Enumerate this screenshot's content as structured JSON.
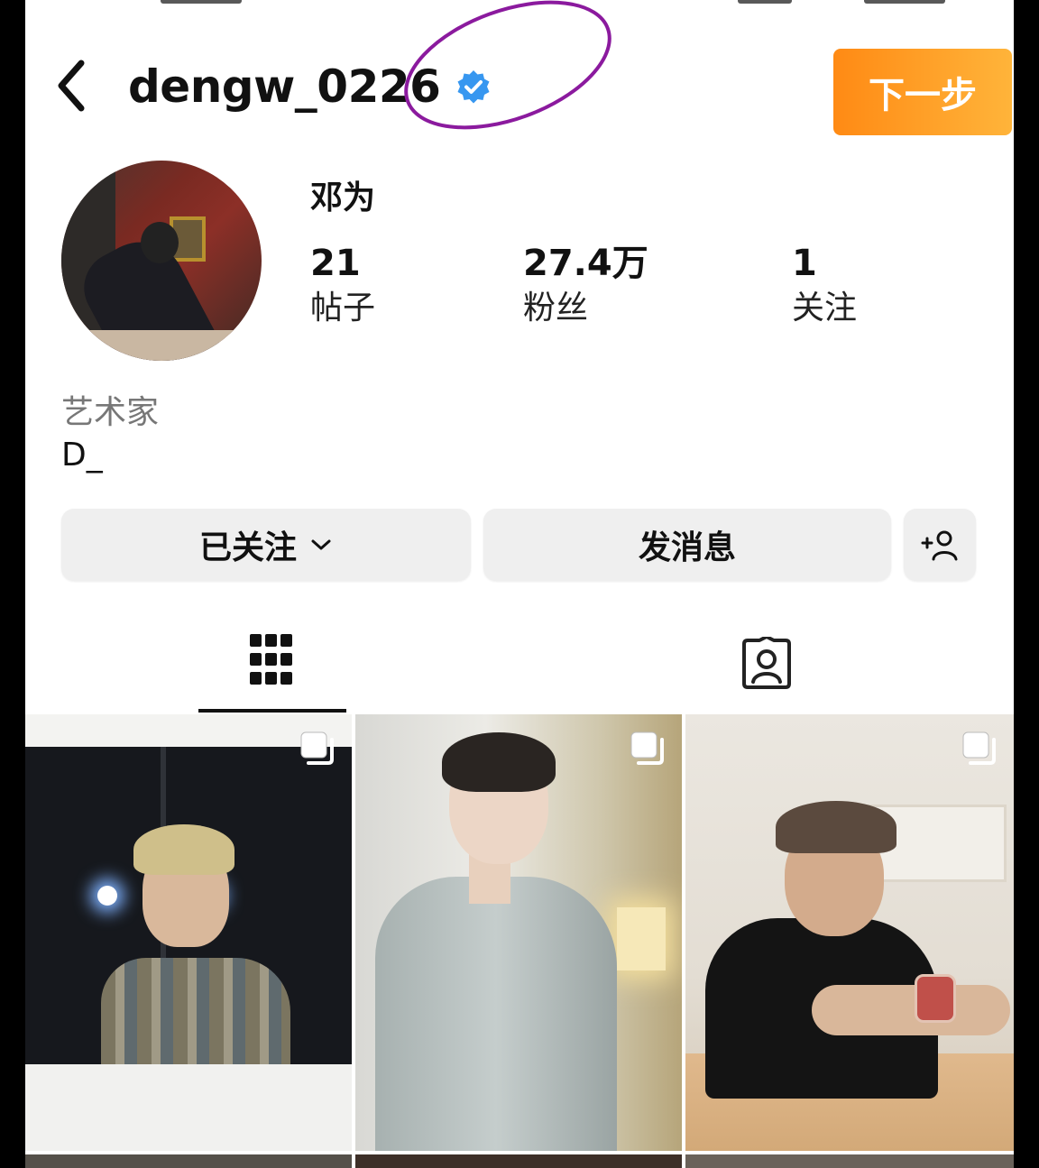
{
  "header": {
    "username": "dengw_0226",
    "next_button_label": "下一步"
  },
  "profile": {
    "display_name": "邓为",
    "stats": [
      {
        "value": "21",
        "label": "帖子"
      },
      {
        "value": "27.4万",
        "label": "粉丝"
      },
      {
        "value": "1",
        "label": "关注"
      }
    ],
    "bio_category": "艺术家",
    "bio_text": "D_"
  },
  "actions": {
    "following_label": "已关注",
    "message_label": "发消息"
  },
  "icons": {
    "back": "chevron-left-icon",
    "verified": "verified-badge-icon",
    "add_person": "add-person-icon",
    "grid": "grid-icon",
    "tagged": "tagged-person-icon",
    "multi_post": "multiple-posts-icon"
  },
  "colors": {
    "verified_blue": "#3797f0",
    "next_button_orange": "#ff9a1f",
    "annotation_purple": "#8b1a9e",
    "button_gray": "#efefef"
  }
}
